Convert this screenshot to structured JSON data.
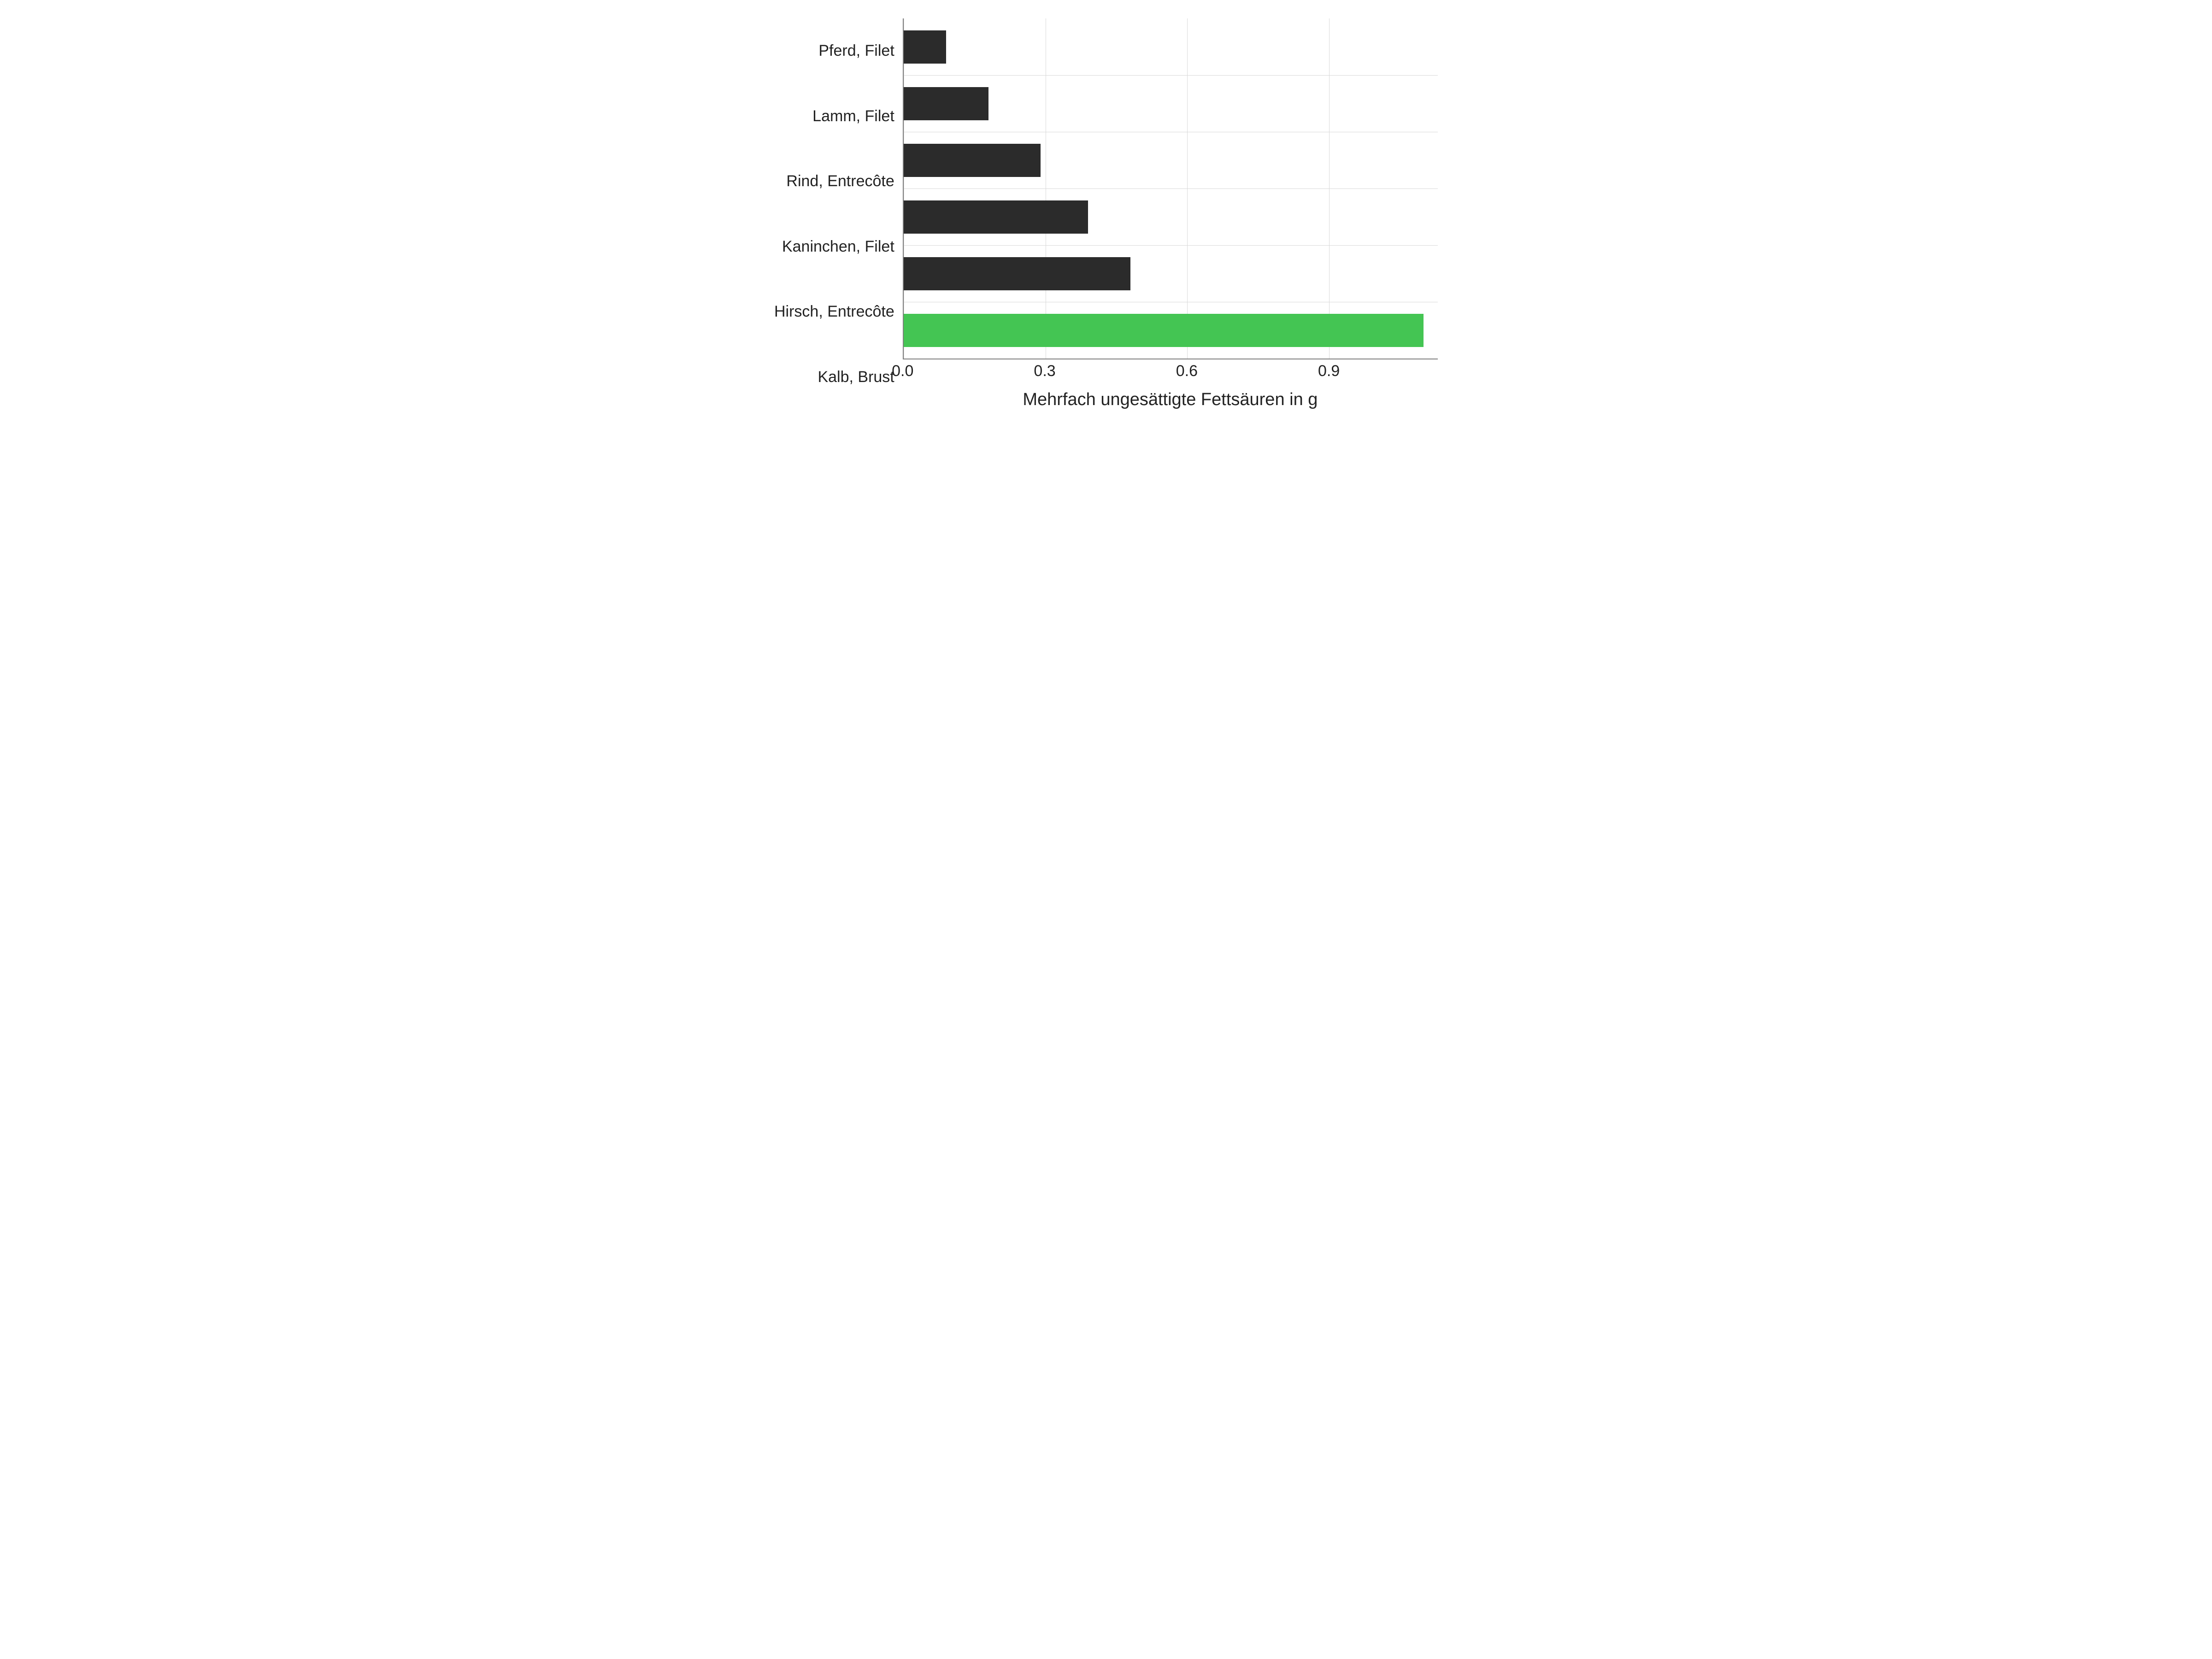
{
  "chart_data": {
    "type": "bar",
    "orientation": "horizontal",
    "categories": [
      "Pferd, Filet",
      "Lamm, Filet",
      "Rind, Entrecôte",
      "Kaninchen, Filet",
      "Hirsch, Entrecôte",
      "Kalb, Brust"
    ],
    "values": [
      0.09,
      0.18,
      0.29,
      0.39,
      0.48,
      1.1
    ],
    "highlight_index": 5,
    "colors": {
      "default": "#2b2b2b",
      "highlight": "#44c553"
    },
    "xlabel": "Mehrfach ungesättigte Fettsäuren in g",
    "ylabel": "",
    "xlim": [
      0.0,
      1.13
    ],
    "x_ticks": [
      0.0,
      0.3,
      0.6,
      0.9
    ],
    "x_tick_labels": [
      "0.0",
      "0.3",
      "0.6",
      "0.9"
    ],
    "title": ""
  }
}
